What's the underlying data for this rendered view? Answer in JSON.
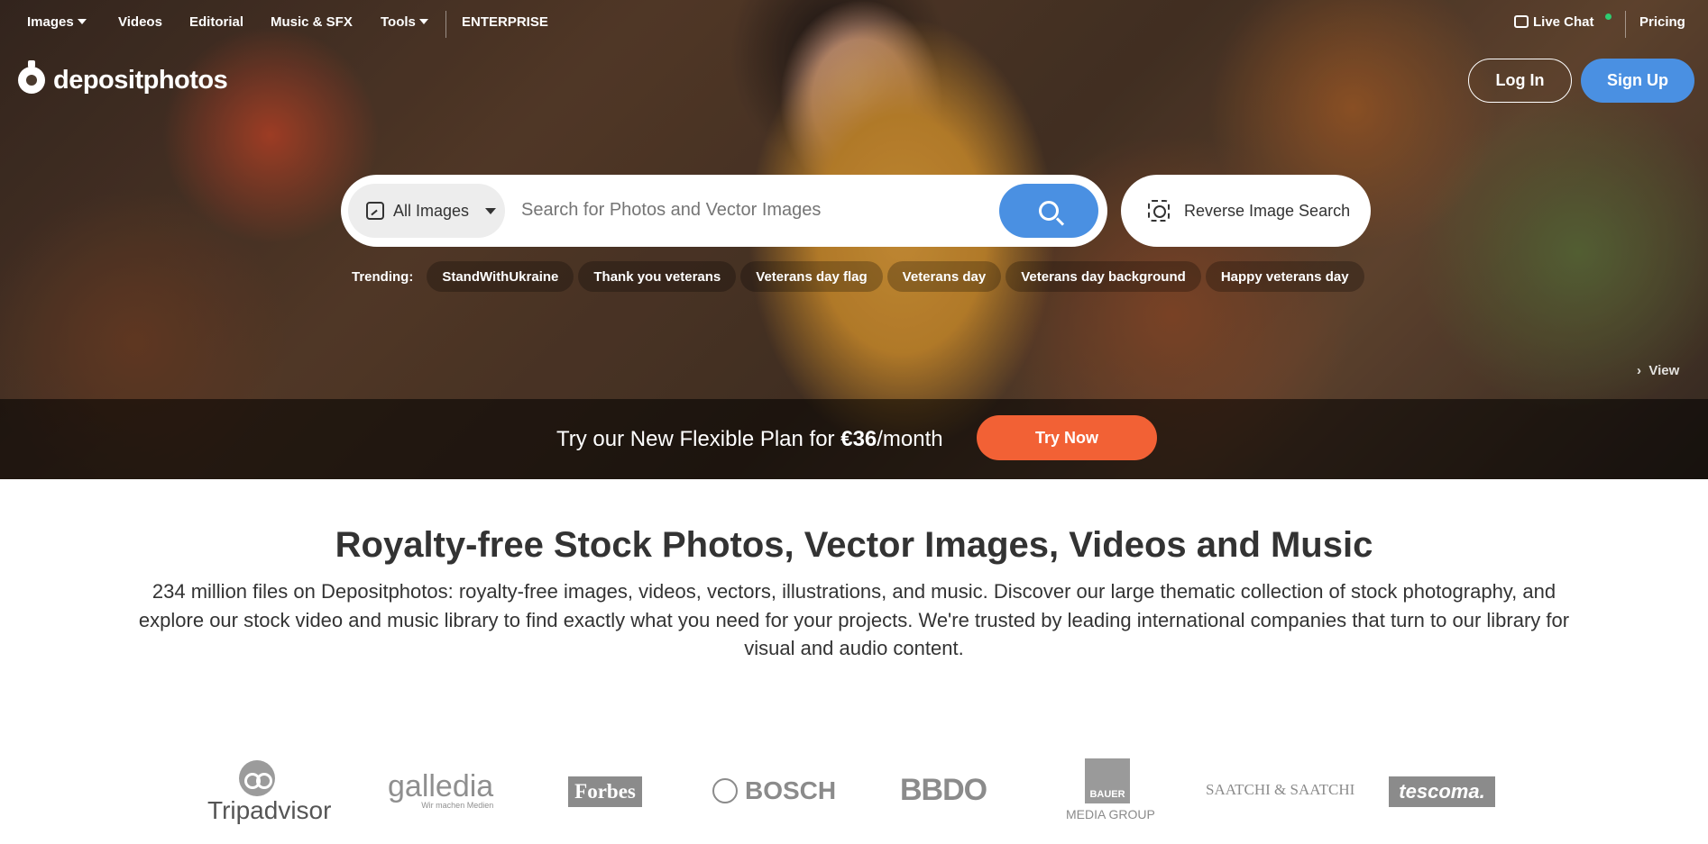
{
  "nav": {
    "images": "Images",
    "videos": "Videos",
    "editorial": "Editorial",
    "music": "Music & SFX",
    "tools": "Tools",
    "enterprise": "ENTERPRISE",
    "live_chat": "Live Chat",
    "pricing": "Pricing"
  },
  "logo": {
    "text": "depositphotos"
  },
  "auth": {
    "login": "Log In",
    "signup": "Sign Up"
  },
  "search": {
    "type_label": "All Images",
    "placeholder": "Search for Photos and Vector Images",
    "reverse_label": "Reverse Image Search"
  },
  "trending": {
    "label": "Trending:",
    "tags": [
      "StandWithUkraine",
      "Thank you veterans",
      "Veterans day flag",
      "Veterans day",
      "Veterans day background",
      "Happy veterans day"
    ]
  },
  "hero": {
    "view_label": "View"
  },
  "promo": {
    "text_before": "Try our New Flexible Plan for ",
    "price": "€36",
    "text_after": "/month",
    "cta": "Try Now"
  },
  "main": {
    "title": "Royalty-free Stock Photos, Vector Images, Videos and Music",
    "description": "234 million files on Depositphotos: royalty-free images, videos, vectors, illustrations, and music. Discover our large thematic collection of stock photography, and explore our stock video and music library to find exactly what you need for your projects. We're trusted by leading international companies that turn to our library for visual and audio content."
  },
  "brands": {
    "tripadvisor": "Tripadvisor",
    "galledia": "galledia",
    "galledia_tagline": "Wir machen Medien",
    "forbes": "Forbes",
    "bosch": "BOSCH",
    "bbdo": "BBDO",
    "bauer_box": "BAUER",
    "bauer": "MEDIA GROUP",
    "saatchi": "SAATCHI & SAATCHI",
    "tescoma": "tescoma."
  },
  "colors": {
    "accent_blue": "#4a90e2",
    "promo_orange": "#f26135",
    "online_green": "#2ecc71"
  }
}
